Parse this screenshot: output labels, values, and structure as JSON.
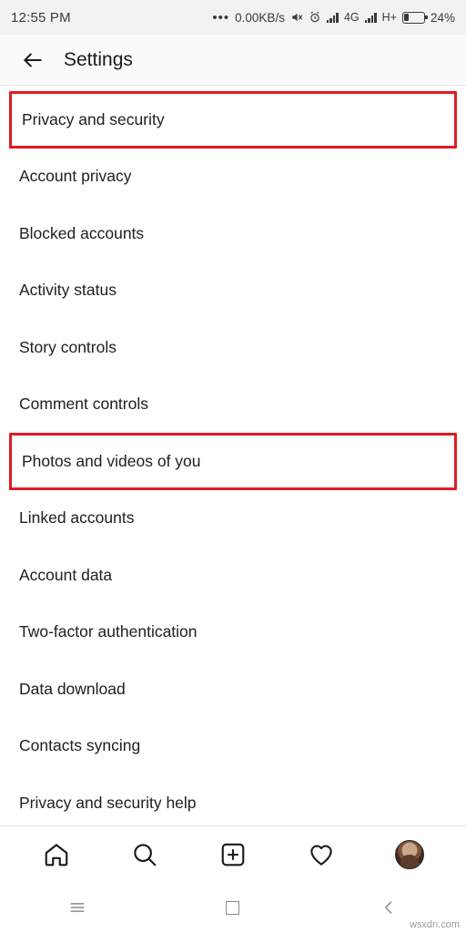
{
  "status_bar": {
    "time": "12:55 PM",
    "dots": "•••",
    "net_speed": "0.00KB/s",
    "icons": [
      "mute-icon",
      "alarm-icon",
      "signal-1-icon",
      "network-4g",
      "signal-2-icon",
      "network-hplus"
    ],
    "network_4g": "4G",
    "network_hplus": "H+",
    "network_hplus_sup": "II",
    "battery_percent": "24%"
  },
  "app_bar": {
    "back_label": "back-arrow",
    "title": "Settings"
  },
  "list": {
    "items": [
      {
        "label": "Privacy and security",
        "highlighted": true
      },
      {
        "label": "Account privacy",
        "highlighted": false
      },
      {
        "label": "Blocked accounts",
        "highlighted": false
      },
      {
        "label": "Activity status",
        "highlighted": false
      },
      {
        "label": "Story controls",
        "highlighted": false
      },
      {
        "label": "Comment controls",
        "highlighted": false
      },
      {
        "label": "Photos and videos of you",
        "highlighted": true
      },
      {
        "label": "Linked accounts",
        "highlighted": false
      },
      {
        "label": "Account data",
        "highlighted": false
      },
      {
        "label": "Two-factor authentication",
        "highlighted": false
      },
      {
        "label": "Data download",
        "highlighted": false
      },
      {
        "label": "Contacts syncing",
        "highlighted": false
      },
      {
        "label": "Privacy and security help",
        "highlighted": false
      }
    ],
    "highlight_color": "#e01b24"
  },
  "bottom_nav": {
    "items": [
      {
        "name": "home-icon"
      },
      {
        "name": "search-icon"
      },
      {
        "name": "add-post-icon"
      },
      {
        "name": "heart-icon"
      },
      {
        "name": "profile-avatar"
      }
    ]
  },
  "system_nav": {
    "items": [
      {
        "name": "menu-icon"
      },
      {
        "name": "home-square-icon"
      },
      {
        "name": "back-chevron-icon"
      }
    ]
  },
  "watermark": "wsxdn.com"
}
